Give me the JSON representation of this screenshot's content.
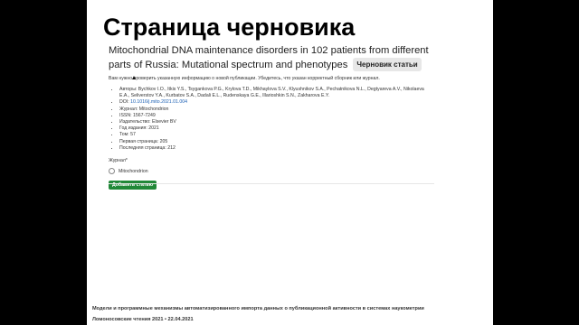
{
  "slide": {
    "title": "Страница черновика",
    "footer": {
      "line1": "Модели и программные механизмы автоматизированного импорта данных о публикационной активности в системах наукометрии",
      "line2": "Ломоносовские чтения 2021 • 22.04.2021"
    }
  },
  "page": {
    "headline": "Mitochondrial DNA maintenance disorders in 102 patients from different parts of Russia: Mutational spectrum and phenotypes",
    "badge": "Черновик статьи",
    "notice": "Вам нужно проверить указанную информацию о новой публикации. Убедитесь, что указан корректный сборник или журнал.",
    "meta": {
      "authors": "Авторы: Bychkov I.O., Itkis Y.S., Tsygankova P.G., Krylova T.D., Mikhaylova S.V., Klyushnikov S.A., Pechatnikova N.L., Degtyareva A.V., Nikolaeva E.A., Seliverstov Y.A., Kurbatov S.A., Dadali E.L., Rudenskaya G.E., Illarioshkin S.N., Zakharova E.Y.",
      "doi_label": "DOI: ",
      "doi_value": "10.1016/j.mito.2021.01.004",
      "journal": "Журнал: Mitochondrion",
      "issn": "ISSN: 1567-7249",
      "publisher": "Издательство: Elsevier BV",
      "year": "Год издания: 2021",
      "volume": "Том: 57",
      "first_page": "Первая страница: 205",
      "last_page": "Последняя страница: 212"
    },
    "journal_field": {
      "label": "Журнал*",
      "option": "Mitochondrion"
    },
    "add_button": "Добавить статью"
  }
}
